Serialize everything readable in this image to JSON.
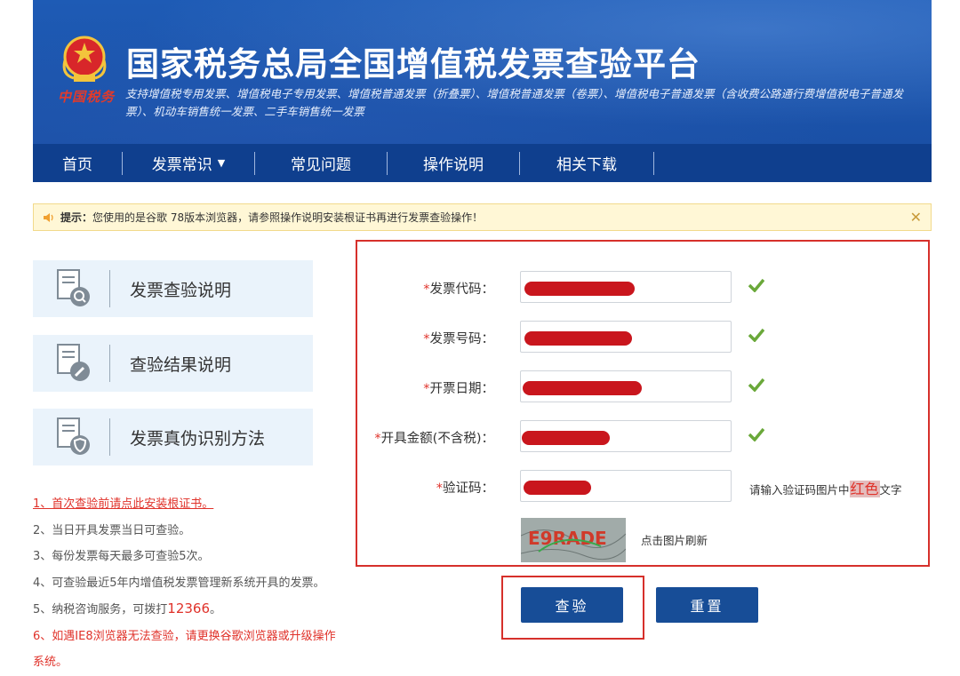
{
  "header": {
    "emblem_text": "中国税务",
    "title": "国家税务总局全国增值税发票查验平台",
    "subtitle": "支持增值税专用发票、增值税电子专用发票、增值税普通发票（折叠票）、增值税普通发票（卷票）、增值税电子普通发票（含收费公路通行费增值税电子普通发票）、机动车销售统一发票、二手车销售统一发票"
  },
  "nav": {
    "items": [
      {
        "label": "首页"
      },
      {
        "label": "发票常识",
        "has_dropdown": true
      },
      {
        "label": "常见问题"
      },
      {
        "label": "操作说明"
      },
      {
        "label": "相关下载"
      }
    ]
  },
  "notice": {
    "prefix": "提示：",
    "text": "您使用的是谷歌 78版本浏览器，请参照操作说明安装根证书再进行发票查验操作！",
    "close": "✕"
  },
  "sidebar": {
    "cards": [
      {
        "label": "发票查验说明",
        "icon": "document-search-icon"
      },
      {
        "label": "查验结果说明",
        "icon": "document-edit-icon"
      },
      {
        "label": "发票真伪识别方法",
        "icon": "document-shield-icon"
      }
    ]
  },
  "tips": {
    "t1": "1、首次查验前请点此安装根证书。",
    "t2": "2、当日开具发票当日可查验。",
    "t3": "3、每份发票每天最多可查验5次。",
    "t4": "4、可查验最近5年内增值税发票管理新系统开具的发票。",
    "t5_prefix": "5、纳税咨询服务，可拨打",
    "t5_number": "12366",
    "t5_suffix": "。",
    "t6": "6、如遇IE8浏览器无法查验，请更换谷歌浏览器或升级操作系统。"
  },
  "form": {
    "required_mark": "*",
    "fields": [
      {
        "label": "发票代码：",
        "valid": true
      },
      {
        "label": "发票号码：",
        "valid": true
      },
      {
        "label": "开票日期：",
        "valid": true
      },
      {
        "label": "开具金额(不含税)：",
        "valid": true
      },
      {
        "label": "验证码：",
        "valid": false
      }
    ],
    "captcha_hint_prefix": "请输入验证码图片中",
    "captcha_hint_highlight": "红色",
    "captcha_hint_suffix": "文字",
    "captcha_text": "E9RADE",
    "captcha_refresh": "点击图片刷新"
  },
  "buttons": {
    "verify": "查验",
    "reset": "重置"
  },
  "colors": {
    "header_blue": "#1a4fa3",
    "nav_blue": "#0f3f8e",
    "button_blue": "#174d97",
    "accent_red": "#d6302b",
    "check_green": "#6aa83a"
  }
}
